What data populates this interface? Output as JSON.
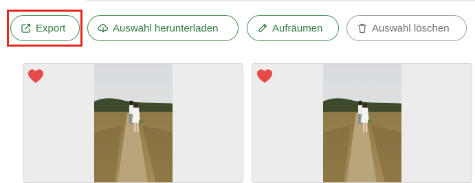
{
  "toolbar": {
    "buttons": [
      {
        "label": "Export",
        "icon": "export-icon"
      },
      {
        "label": "Auswahl herunterladen",
        "icon": "cloud-download-icon"
      },
      {
        "label": "Aufräumen",
        "icon": "pencil-icon"
      },
      {
        "label": "Auswahl löschen",
        "icon": "trash-icon"
      }
    ]
  },
  "gallery": {
    "items": [
      {
        "favorite": true,
        "favorite_icon": "heart-icon"
      },
      {
        "favorite": true,
        "favorite_icon": "heart-icon"
      }
    ]
  },
  "colors": {
    "accent": "#2f7a3d",
    "favorite": "#e84a4a",
    "highlight": "#e5261f",
    "disabled": "#6b6b6b"
  }
}
